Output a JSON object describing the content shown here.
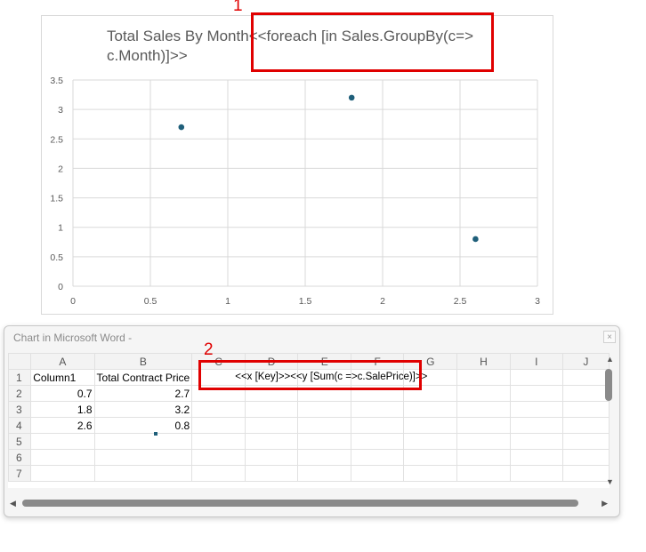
{
  "chart": {
    "title": "Total Sales By Month<<foreach [in Sales.GroupBy(c=>\nc.Month)]>>"
  },
  "chart_data": {
    "type": "scatter",
    "title": "Total Sales By Month<<foreach [in Sales.GroupBy(c=> c.Month)]>>",
    "x": [
      0.7,
      1.8,
      2.6
    ],
    "y": [
      2.7,
      3.2,
      0.8
    ],
    "xlim": [
      0,
      3
    ],
    "ylim": [
      0,
      3.5
    ],
    "x_ticks": [
      "0",
      "0.5",
      "1",
      "1.5",
      "2",
      "2.5",
      "3"
    ],
    "y_ticks": [
      "0",
      "0.5",
      "1",
      "1.5",
      "2",
      "2.5",
      "3",
      "3.5"
    ],
    "grid": true,
    "marker_color": "#1f5f7a"
  },
  "callouts": [
    "1",
    "2"
  ],
  "window": {
    "title": "Chart in Microsoft Word -",
    "close_label": "×"
  },
  "sheet": {
    "columns": [
      "A",
      "B",
      "C",
      "D",
      "E",
      "F",
      "G",
      "H",
      "I",
      "J"
    ],
    "rows": [
      "1",
      "2",
      "3",
      "4",
      "5",
      "6",
      "7"
    ],
    "header_a": "Column1",
    "header_b": "Total Contract Price",
    "header_c": "<<x [Key]>><<y [Sum(c =>c.SalePrice)]>>",
    "data": [
      [
        "0.7",
        "2.7"
      ],
      [
        "1.8",
        "3.2"
      ],
      [
        "2.6",
        "0.8"
      ]
    ]
  },
  "colors": {
    "callout": "#e00000",
    "marker": "#1f5f7a"
  }
}
